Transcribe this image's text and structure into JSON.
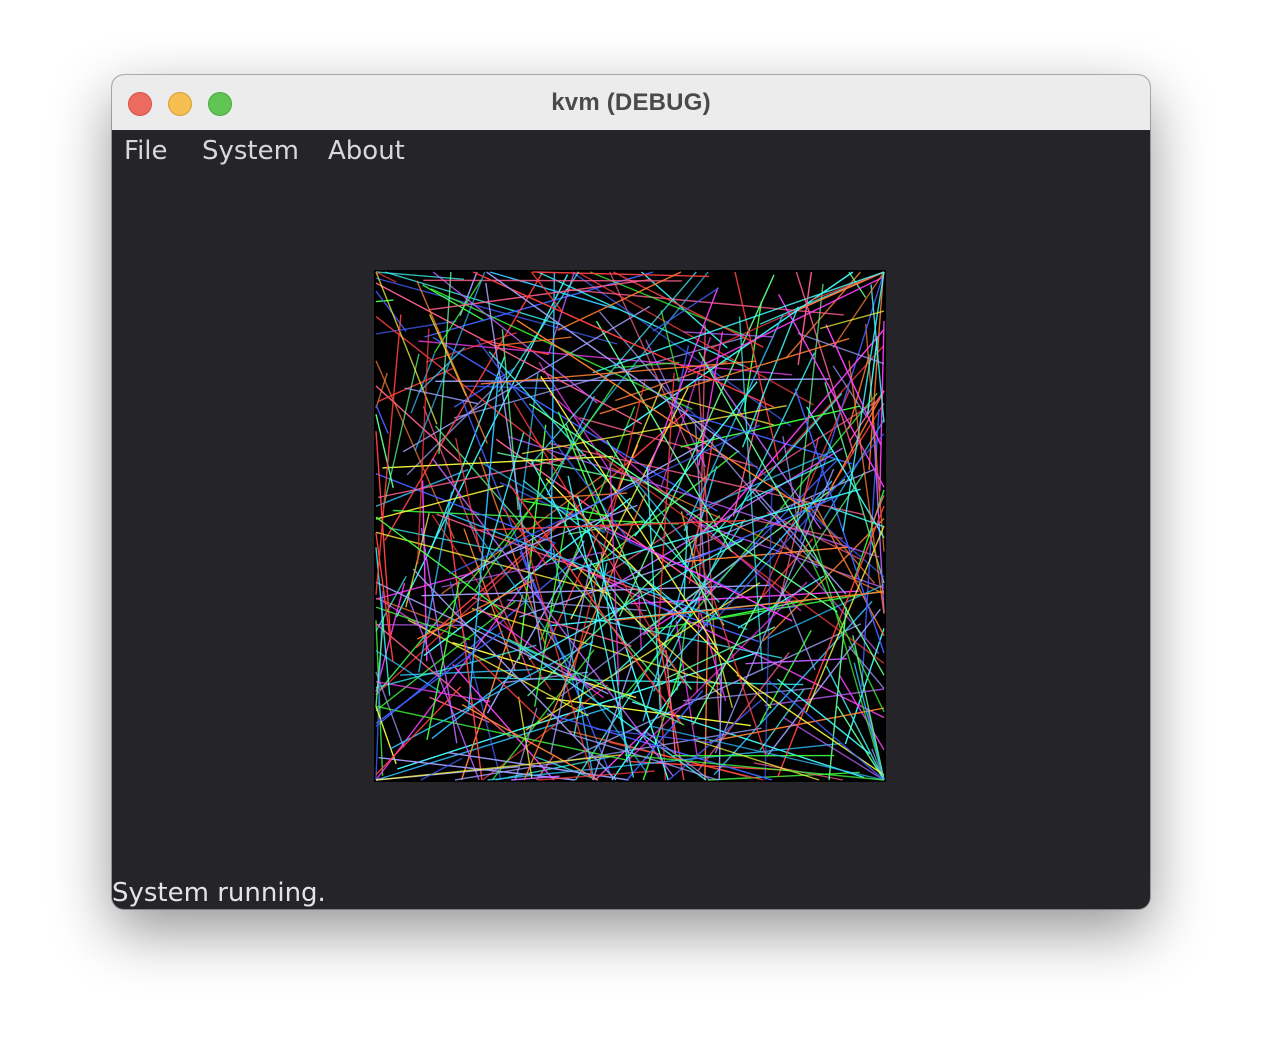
{
  "window": {
    "title": "kvm (DEBUG)"
  },
  "menu": {
    "file": "File",
    "system": "System",
    "about": "About"
  },
  "display": {
    "background_color": "#000000",
    "content": "random colored lines",
    "line_palette": [
      "#ff4040",
      "#40ff40",
      "#4060ff",
      "#ff40ff",
      "#40ffff",
      "#ffff40",
      "#ff8030",
      "#a0a0ff",
      "#60ff90",
      "#c060ff",
      "#ff6090",
      "#30c0ff"
    ]
  },
  "status": {
    "text": "System running."
  },
  "colors": {
    "window_bg": "#252428",
    "titlebar_bg": "#ececec",
    "close": "#ed6a5e",
    "minimize": "#f5bf4f",
    "zoom": "#61c554"
  }
}
